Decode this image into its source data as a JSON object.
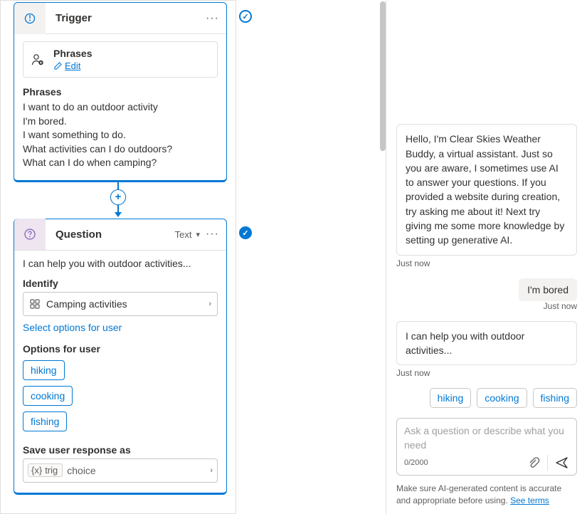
{
  "trigger": {
    "title": "Trigger",
    "phrases_label": "Phrases",
    "edit_label": "Edit",
    "section_header": "Phrases",
    "phrases": [
      "I want to do an outdoor activity",
      "I'm bored.",
      "I want something to do.",
      "What activities can I do outdoors?",
      "What can I do when camping?"
    ]
  },
  "question": {
    "title": "Question",
    "type_label": "Text",
    "prompt": "I can help you with outdoor activities...",
    "identify_label": "Identify",
    "identify_value": "Camping activities",
    "select_link": "Select options for user",
    "options_label": "Options for user",
    "options": [
      "hiking",
      "cooking",
      "fishing"
    ],
    "save_label": "Save user response as",
    "var_name": "trig",
    "var_type": "choice"
  },
  "chat": {
    "bot_intro": "Hello, I'm Clear Skies Weather Buddy, a virtual assistant. Just so you are aware, I sometimes use AI to answer your questions. If you provided a website during creation, try asking me about it! Next try giving me some more knowledge by setting up generative AI.",
    "ts1": "Just now",
    "user_msg": "I'm bored",
    "ts2": "Just now",
    "bot_reply": "I can help you with outdoor activities...",
    "ts3": "Just now",
    "suggestions": [
      "hiking",
      "cooking",
      "fishing"
    ],
    "placeholder": "Ask a question or describe what you need",
    "counter": "0/2000",
    "footer_a": "Make sure AI-generated content is accurate and appropriate before using. ",
    "footer_link": "See terms"
  }
}
